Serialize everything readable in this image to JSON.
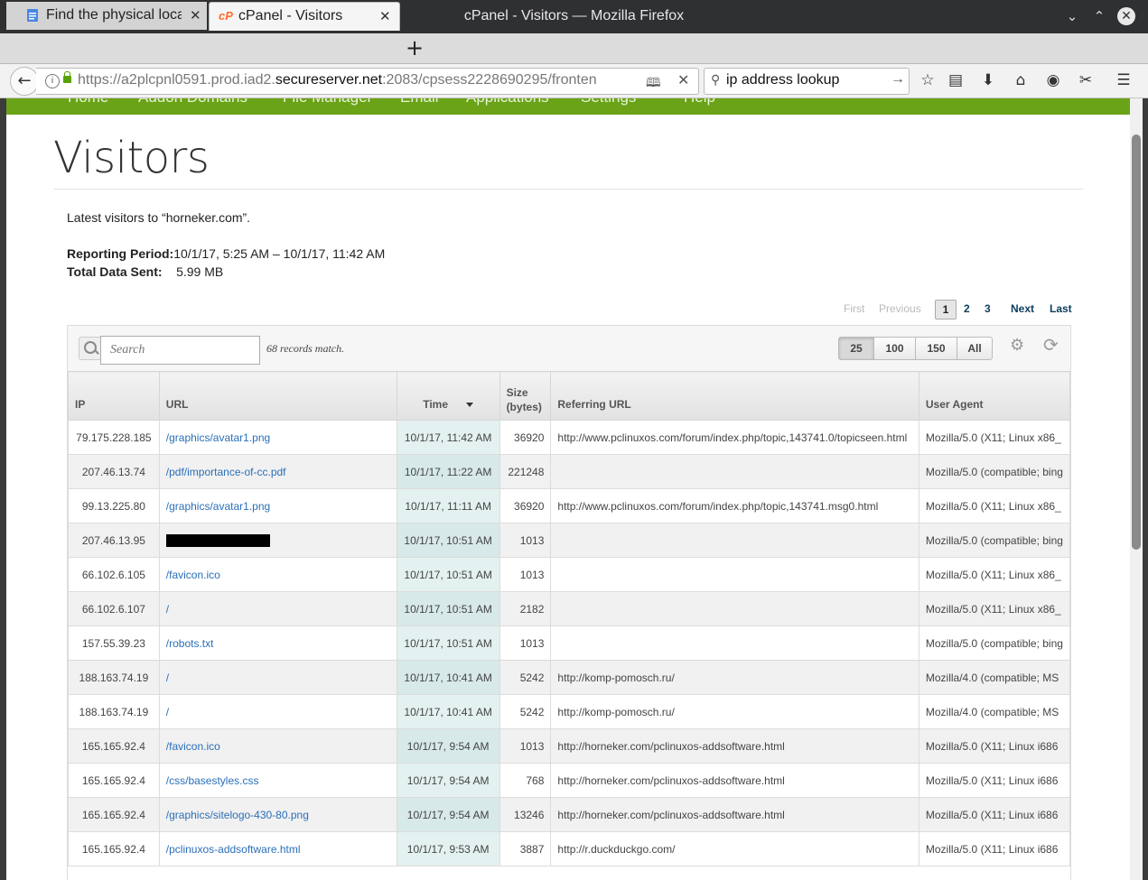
{
  "window": {
    "title": "cPanel - Visitors — Mozilla Firefox"
  },
  "tabs": [
    {
      "label": "Find the physical loca"
    },
    {
      "label": "cPanel - Visitors"
    }
  ],
  "urlbar": {
    "prefix": "https://a2plcpnl0591.prod.iad2.",
    "domain": "secureserver.net",
    "suffix": ":2083/cpsess2228690295/fronten"
  },
  "searchbar": {
    "value": "ip address lookup"
  },
  "cpanel_nav": [
    "Home",
    "Addon Domains",
    "File Manager",
    "Email",
    "Applications",
    "Settings",
    "Help"
  ],
  "page": {
    "title": "Visitors",
    "latest": "Latest visitors to “horneker.com”.",
    "reporting_label": "Reporting Period:",
    "reporting_value": "10/1/17, 5:25 AM  –  10/1/17, 11:42 AM",
    "total_label": "Total Data Sent:",
    "total_value": "5.99 MB"
  },
  "pager": {
    "first": "First",
    "previous": "Previous",
    "pages": [
      "1",
      "2",
      "3"
    ],
    "next": "Next",
    "last": "Last"
  },
  "toolbar": {
    "search_placeholder": "Search",
    "match_text": "68 records match.",
    "page_sizes": [
      "25",
      "100",
      "150",
      "All"
    ]
  },
  "table": {
    "headers": [
      "IP",
      "URL",
      "Time",
      "Size\n(bytes)",
      "Referring URL",
      "User Agent"
    ],
    "rows": [
      {
        "ip": "79.175.228.185",
        "url": "/graphics/avatar1.png",
        "time": "10/1/17, 11:42 AM",
        "size": "36920",
        "ref": "http://www.pclinuxos.com/forum/index.php/topic,143741.0/topicseen.html",
        "ua": "Mozilla/5.0 (X11; Linux x86_"
      },
      {
        "ip": "207.46.13.74",
        "url": "/pdf/importance-of-cc.pdf",
        "time": "10/1/17, 11:22 AM",
        "size": "221248",
        "ref": "",
        "ua": "Mozilla/5.0 (compatible; bing"
      },
      {
        "ip": "99.13.225.80",
        "url": "/graphics/avatar1.png",
        "time": "10/1/17, 11:11 AM",
        "size": "36920",
        "ref": "http://www.pclinuxos.com/forum/index.php/topic,143741.msg0.html",
        "ua": "Mozilla/5.0 (X11; Linux x86_"
      },
      {
        "ip": "207.46.13.95",
        "url": "",
        "time": "10/1/17, 10:51 AM",
        "size": "1013",
        "ref": "",
        "ua": "Mozilla/5.0 (compatible; bing"
      },
      {
        "ip": "66.102.6.105",
        "url": "/favicon.ico",
        "time": "10/1/17, 10:51 AM",
        "size": "1013",
        "ref": "",
        "ua": "Mozilla/5.0 (X11; Linux x86_"
      },
      {
        "ip": "66.102.6.107",
        "url": "/",
        "time": "10/1/17, 10:51 AM",
        "size": "2182",
        "ref": "",
        "ua": "Mozilla/5.0 (X11; Linux x86_"
      },
      {
        "ip": "157.55.39.23",
        "url": "/robots.txt",
        "time": "10/1/17, 10:51 AM",
        "size": "1013",
        "ref": "",
        "ua": "Mozilla/5.0 (compatible; bing"
      },
      {
        "ip": "188.163.74.19",
        "url": "/",
        "time": "10/1/17, 10:41 AM",
        "size": "5242",
        "ref": "http://komp-pomosch.ru/",
        "ua": "Mozilla/4.0 (compatible; MS"
      },
      {
        "ip": "188.163.74.19",
        "url": "/",
        "time": "10/1/17, 10:41 AM",
        "size": "5242",
        "ref": "http://komp-pomosch.ru/",
        "ua": "Mozilla/4.0 (compatible; MS"
      },
      {
        "ip": "165.165.92.4",
        "url": "/favicon.ico",
        "time": "10/1/17, 9:54 AM",
        "size": "1013",
        "ref": "http://horneker.com/pclinuxos-addsoftware.html",
        "ua": "Mozilla/5.0 (X11; Linux i686"
      },
      {
        "ip": "165.165.92.4",
        "url": "/css/basestyles.css",
        "time": "10/1/17, 9:54 AM",
        "size": "768",
        "ref": "http://horneker.com/pclinuxos-addsoftware.html",
        "ua": "Mozilla/5.0 (X11; Linux i686"
      },
      {
        "ip": "165.165.92.4",
        "url": "/graphics/sitelogo-430-80.png",
        "time": "10/1/17, 9:54 AM",
        "size": "13246",
        "ref": "http://horneker.com/pclinuxos-addsoftware.html",
        "ua": "Mozilla/5.0 (X11; Linux i686"
      },
      {
        "ip": "165.165.92.4",
        "url": "/pclinuxos-addsoftware.html",
        "time": "10/1/17, 9:53 AM",
        "size": "3887",
        "ref": "http://r.duckduckgo.com/",
        "ua": "Mozilla/5.0 (X11; Linux i686"
      }
    ]
  }
}
